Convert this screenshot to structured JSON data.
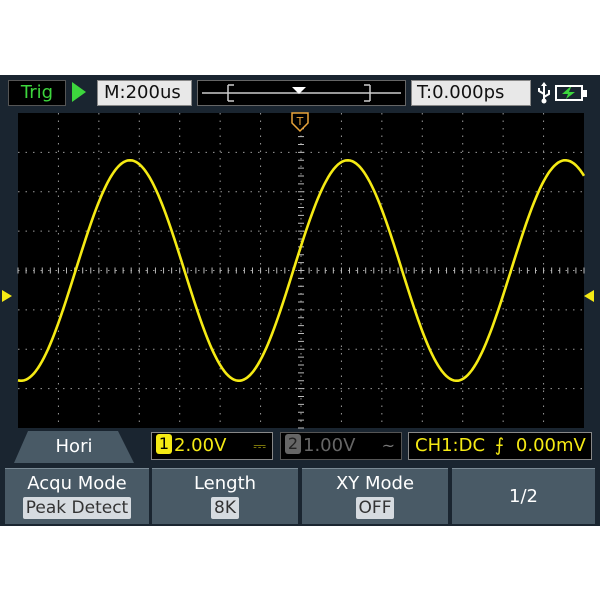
{
  "topbar": {
    "trig_status": "Trig",
    "timebase": "M:200us",
    "trigger_offset": "T:0.000ps"
  },
  "bottom": {
    "tab_label": "Hori",
    "ch1_number": "1",
    "ch1_scale": "2.00V",
    "ch1_coupling": "⎓",
    "ch2_number": "2",
    "ch2_scale": "1.00V",
    "ch2_coupling": "~",
    "trigger_info": "CH1:DC",
    "trigger_slope": "⨍",
    "trigger_level": "0.00mV"
  },
  "menu": [
    {
      "title": "Acqu Mode",
      "value": "Peak Detect"
    },
    {
      "title": "Length",
      "value": "8K"
    },
    {
      "title": "XY Mode",
      "value": "OFF"
    },
    {
      "title": "1/2",
      "value": ""
    }
  ],
  "waveform": {
    "color": "#f5ea14",
    "shape": "sine",
    "cycles_visible": 2.6,
    "amplitude_divisions": 2,
    "vertical_divisions": 8,
    "horizontal_divisions": 14
  },
  "colors": {
    "frame": "#1a2530",
    "screen": "#000000",
    "ch1": "#f5ea14",
    "status_green": "#3dd63d",
    "trigger_marker": "#e8a33a"
  },
  "icons": [
    "run-arrow-icon",
    "usb-icon",
    "battery-charging-icon",
    "trigger-position-icon",
    "ch1-ground-marker-icon",
    "trigger-level-marker-icon"
  ]
}
